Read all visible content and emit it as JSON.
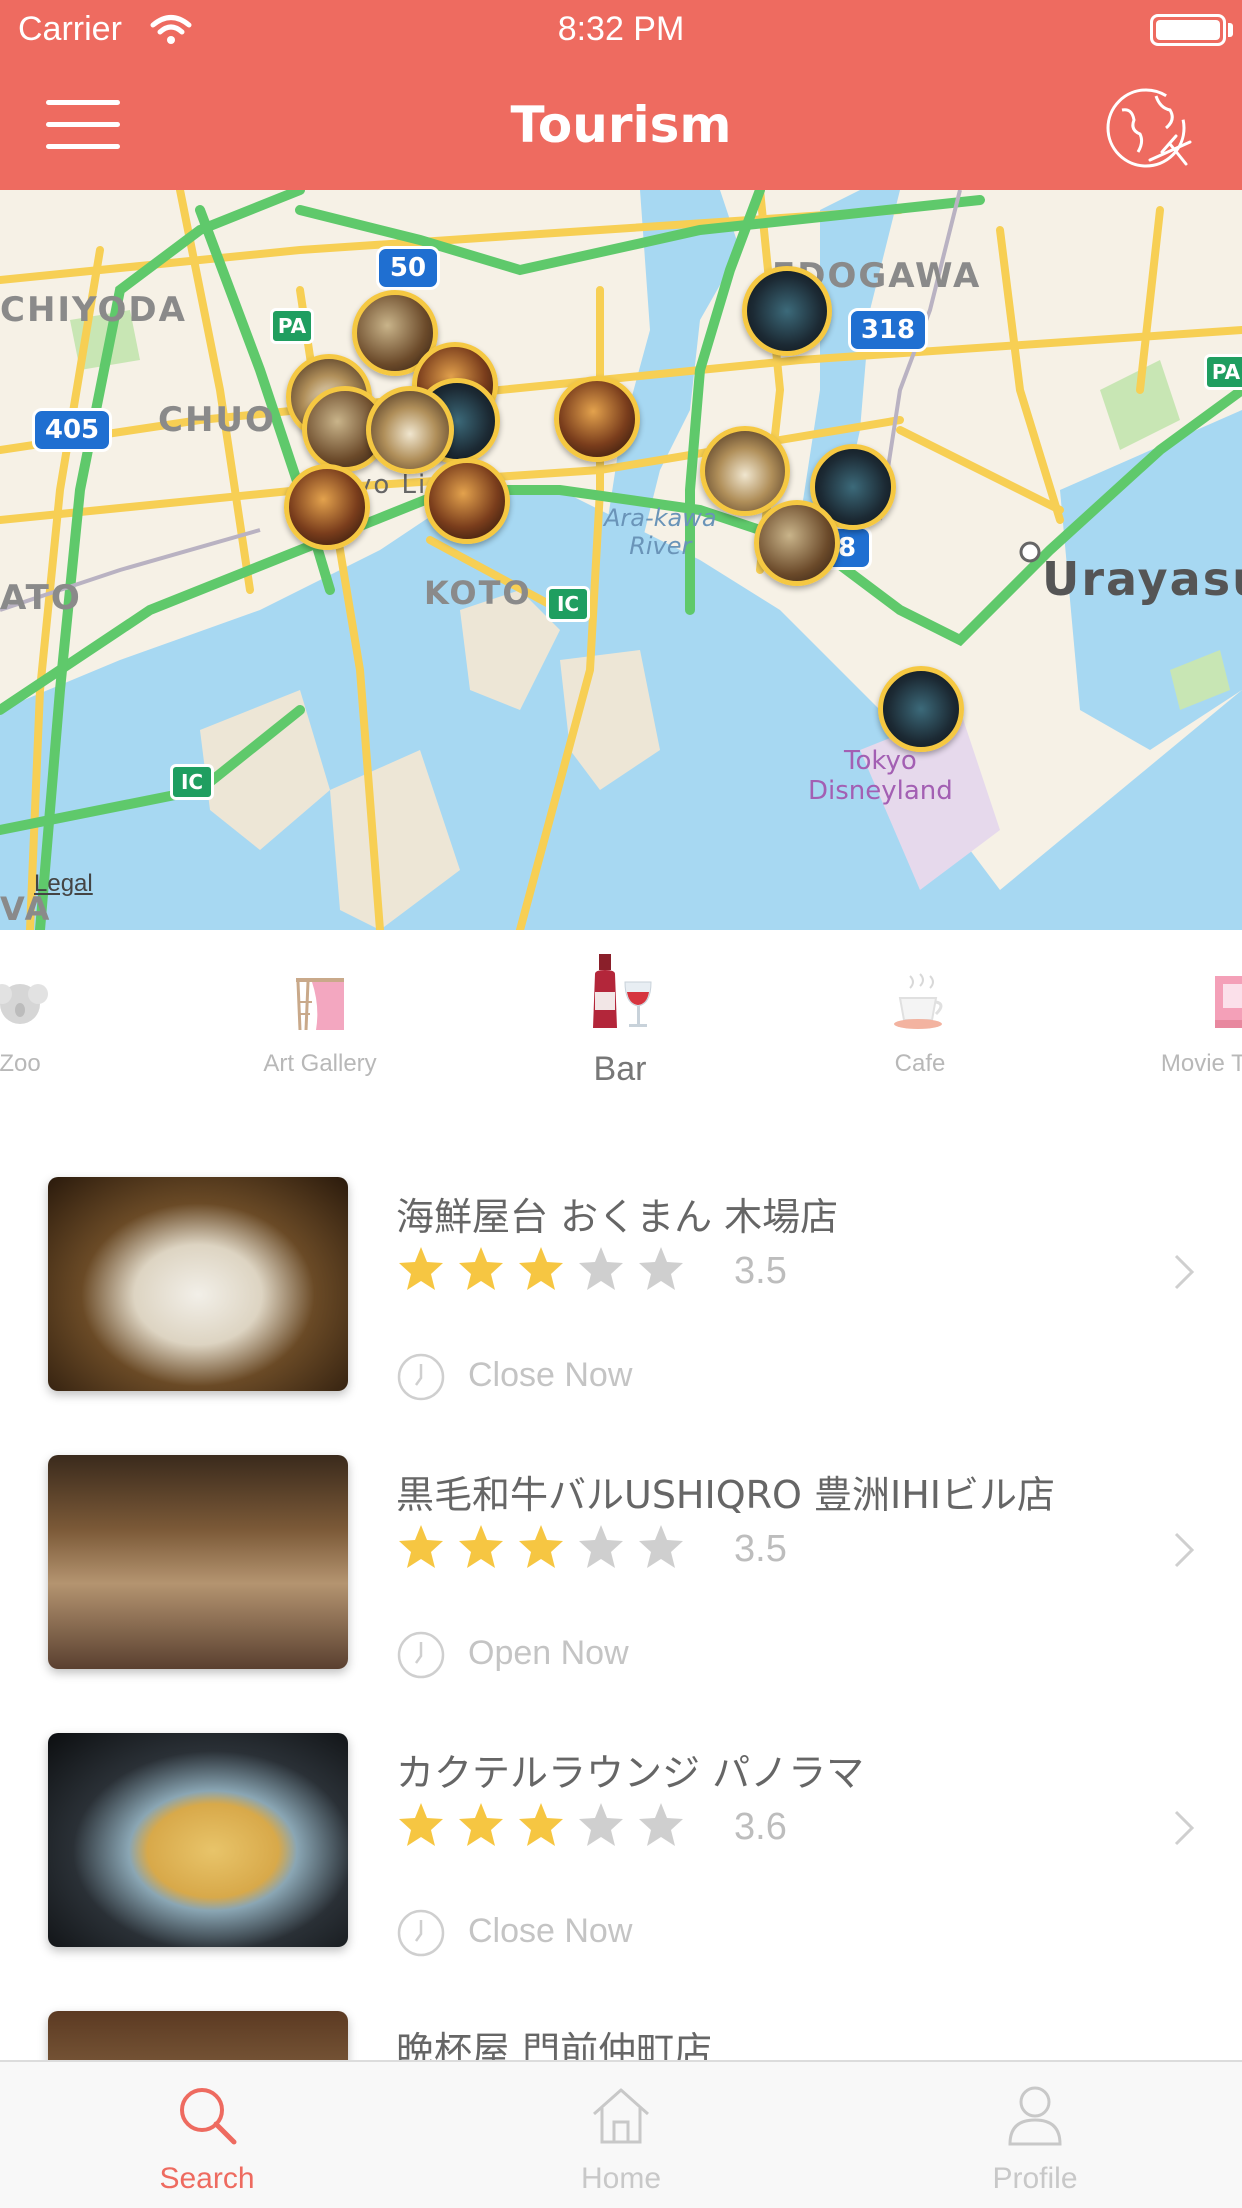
{
  "status_bar": {
    "carrier": "Carrier",
    "time": "8:32 PM"
  },
  "header": {
    "title": "Tourism",
    "menu_icon": "hamburger-icon",
    "globe_icon": "globe-plane-icon"
  },
  "colors": {
    "brand": "#ee6b60",
    "star_filled": "#f6c642",
    "star_empty": "#cfcfcf",
    "pin_border": "#f5c842"
  },
  "map": {
    "labels": {
      "chiyoda": "CHIYODA",
      "chuo": "CHUO",
      "koto": "KOTO",
      "edogawa": "EDOGAWA",
      "urayasu": "Urayasu",
      "arakawa": "Ara-kawa\nRiver",
      "disney": "Tokyo\nDisneyland",
      "minato": "ATO",
      "vo_li": "vo Li",
      "va": "VA"
    },
    "shields": {
      "r50": "50",
      "r318": "318",
      "r405": "405",
      "r318b": "8",
      "pa": "PA",
      "pa2": "PA",
      "ic": "IC"
    },
    "legal": "Legal"
  },
  "categories": [
    {
      "label": "Zoo",
      "icon": "koala-icon"
    },
    {
      "label": "Art Gallery",
      "icon": "art-easel-icon"
    },
    {
      "label": "Bar",
      "icon": "wine-bottle-icon",
      "active": true
    },
    {
      "label": "Cafe",
      "icon": "coffee-cup-icon"
    },
    {
      "label": "Movie Th",
      "icon": "movie-theater-icon"
    }
  ],
  "places": [
    {
      "name": "海鮮屋台 おくまん 木場店",
      "rating": "3.5",
      "stars": 3,
      "status": "Close Now"
    },
    {
      "name": "黒毛和牛バルUSHIQRO 豊洲IHIビル店",
      "rating": "3.5",
      "stars": 3,
      "status": "Open Now"
    },
    {
      "name": "カクテルラウンジ パノラマ",
      "rating": "3.6",
      "stars": 3,
      "status": "Close Now"
    },
    {
      "name": "晩杯屋 門前仲町店",
      "rating": "",
      "stars": 0,
      "status": ""
    }
  ],
  "tabs": [
    {
      "label": "Search",
      "icon": "search-icon",
      "active": true
    },
    {
      "label": "Home",
      "icon": "home-icon"
    },
    {
      "label": "Profile",
      "icon": "profile-icon"
    }
  ]
}
